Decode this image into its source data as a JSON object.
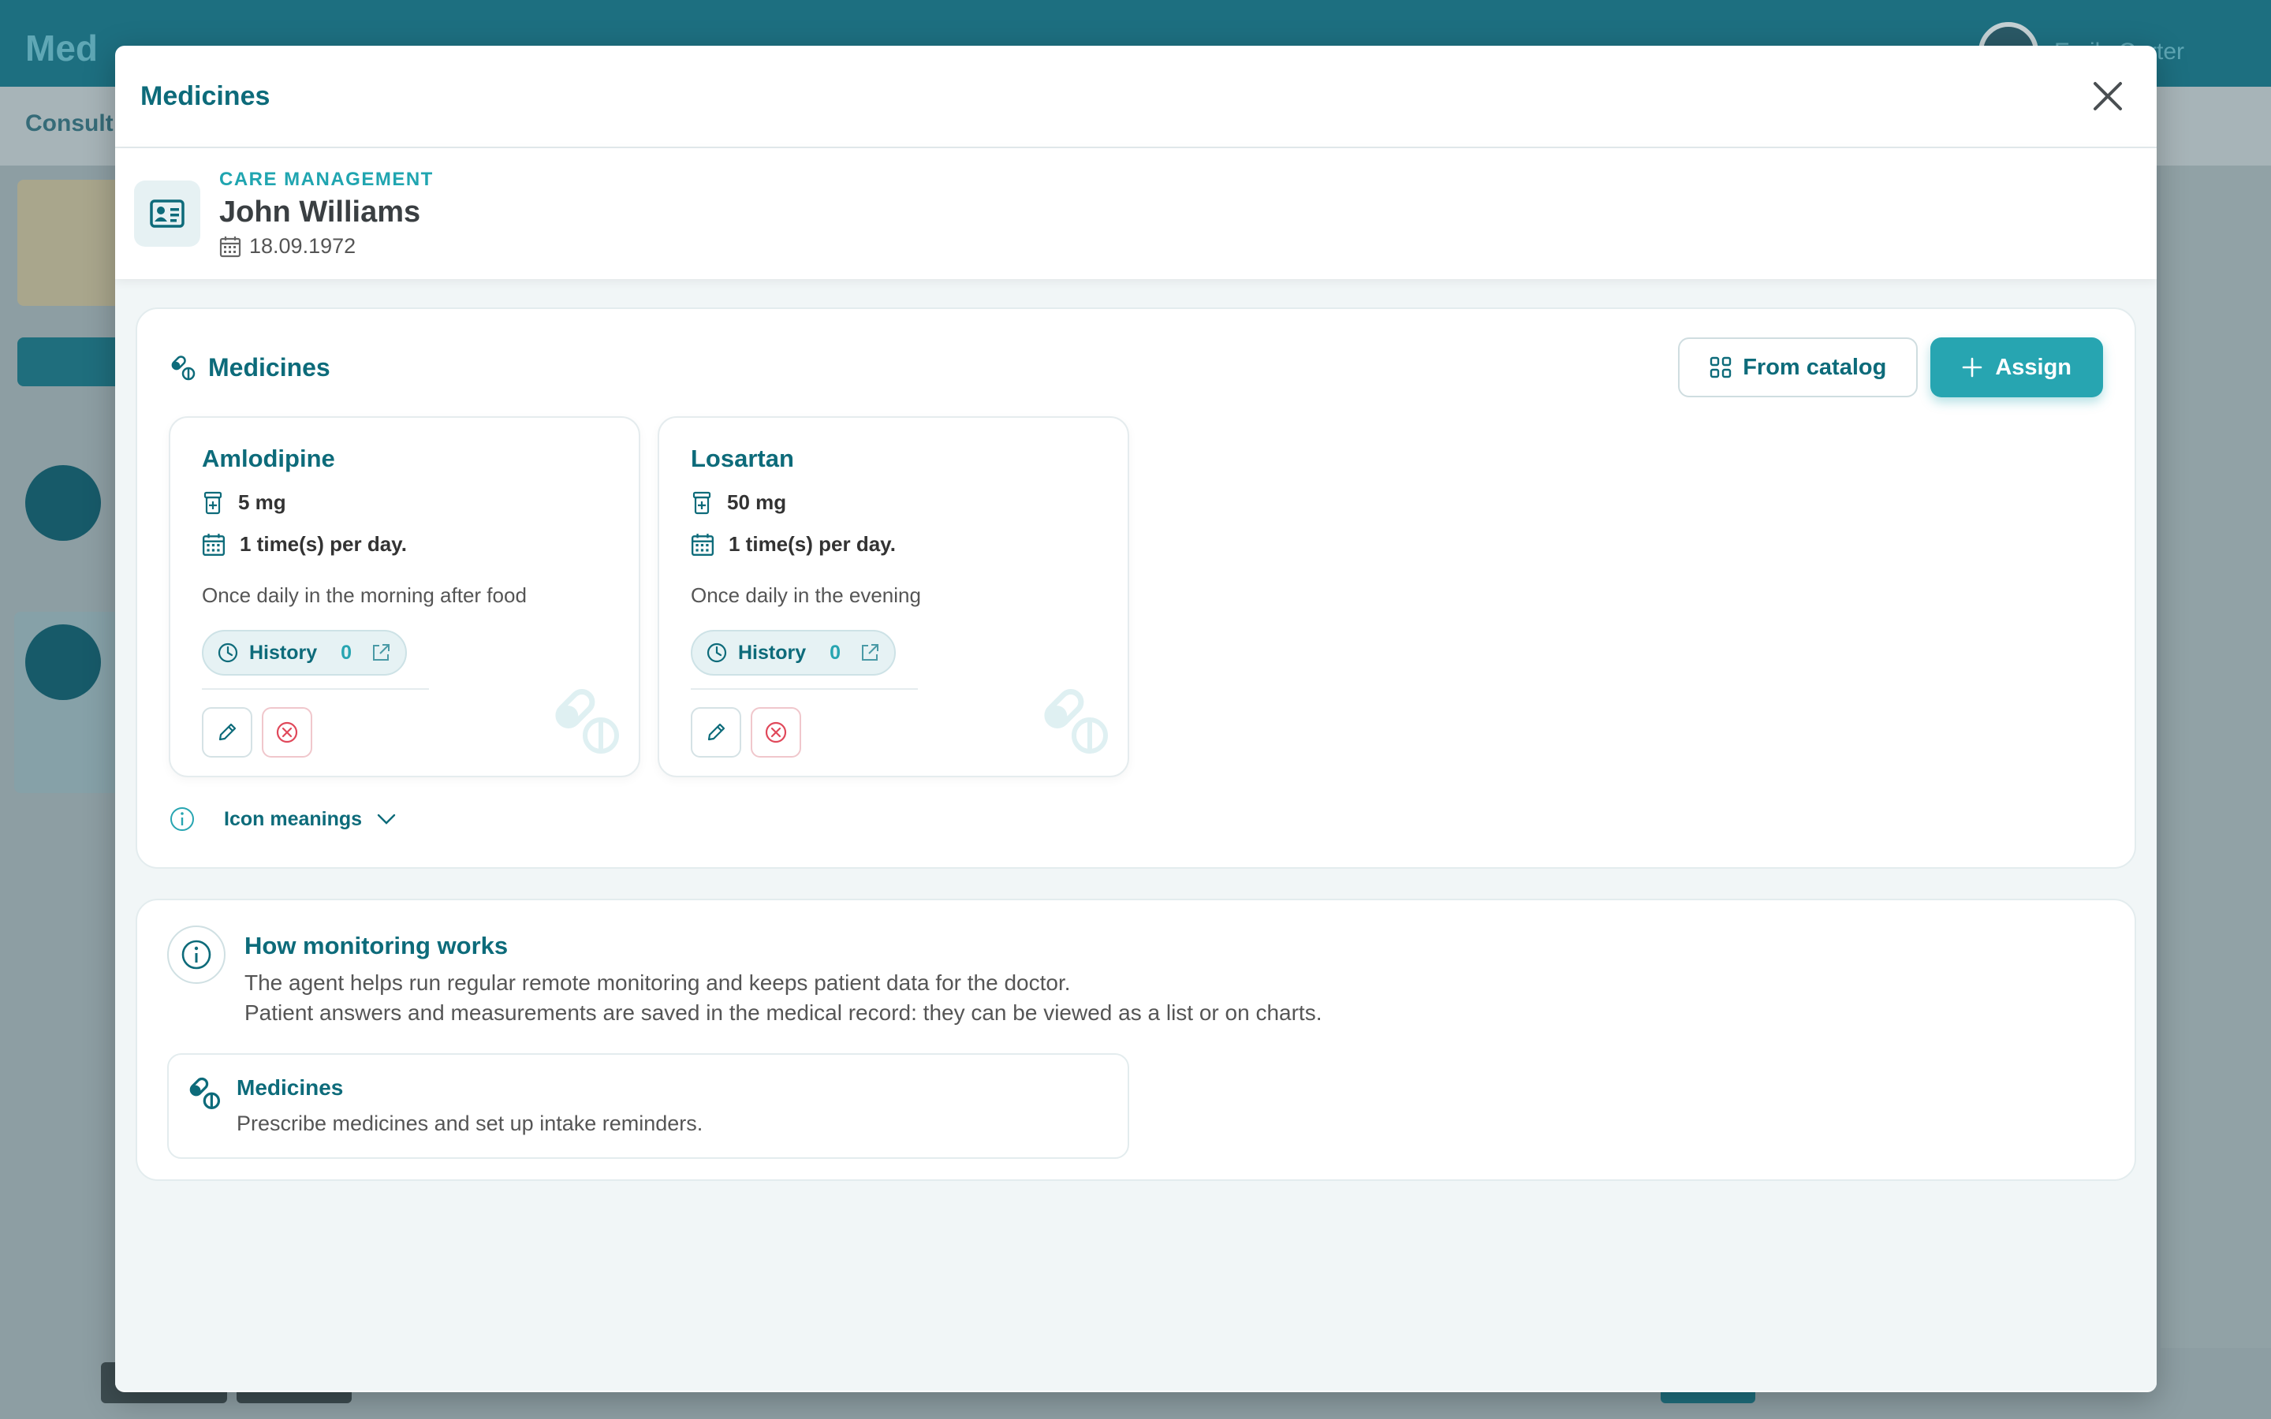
{
  "background": {
    "logo": "Med",
    "user_name": "Emily Carter",
    "nav_label": "Consult"
  },
  "modal": {
    "title": "Medicines"
  },
  "patient": {
    "caption": "CARE MANAGEMENT",
    "name": "John Williams",
    "dob": "18.09.1972"
  },
  "medicines_section": {
    "title": "Medicines",
    "from_catalog_label": "From catalog",
    "assign_label": "Assign",
    "cards": [
      {
        "name": "Amlodipine",
        "dose": "5 mg",
        "frequency": "1 time(s) per day.",
        "note": "Once daily in the morning after food",
        "history_label": "History",
        "history_count": "0"
      },
      {
        "name": "Losartan",
        "dose": "50 mg",
        "frequency": "1 time(s) per day.",
        "note": "Once daily in the evening",
        "history_label": "History",
        "history_count": "0"
      }
    ],
    "icon_meanings_label": "Icon meanings"
  },
  "monitoring": {
    "title": "How monitoring works",
    "line1": "The agent helps run regular remote monitoring and keeps patient data for the doctor.",
    "line2": "Patient answers and measurements are saved in the medical record: they can be viewed as a list or on charts.",
    "card_title": "Medicines",
    "card_text": "Prescribe medicines and set up intake reminders."
  },
  "colors": {
    "accent": "#27a5b1",
    "primary_text": "#0d6b7a",
    "danger": "#e0485a"
  }
}
